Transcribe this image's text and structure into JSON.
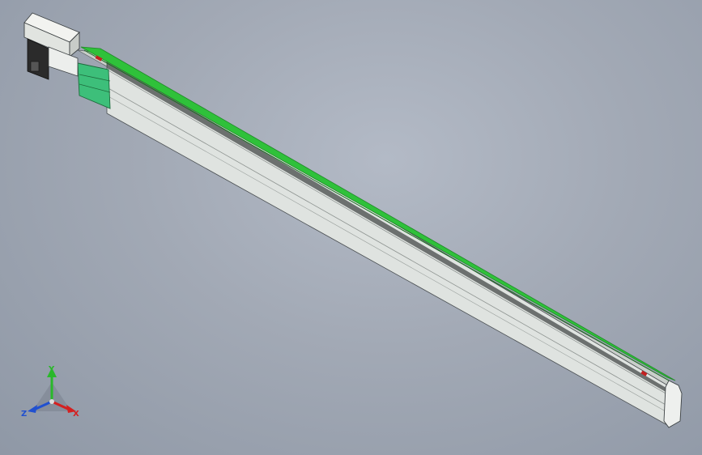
{
  "viewport": {
    "background": "#a4abb7",
    "model": {
      "name": "linear-module",
      "colors": {
        "body": "#dfe3e0",
        "body_shadow": "#b9bfbb",
        "rail": "#2fc13a",
        "rail_dark": "#1f8a27",
        "carriage": "#3dbf7a",
        "motor": "#e8eae6",
        "motor_dark": "#2b2b2b",
        "marker": "#c42020",
        "edge": "#4a4f52"
      }
    },
    "triad": {
      "x_label": "X",
      "y_label": "Y",
      "z_label": "Z",
      "x_color": "#d42020",
      "y_color": "#2ab82a",
      "z_color": "#2050d0"
    }
  }
}
